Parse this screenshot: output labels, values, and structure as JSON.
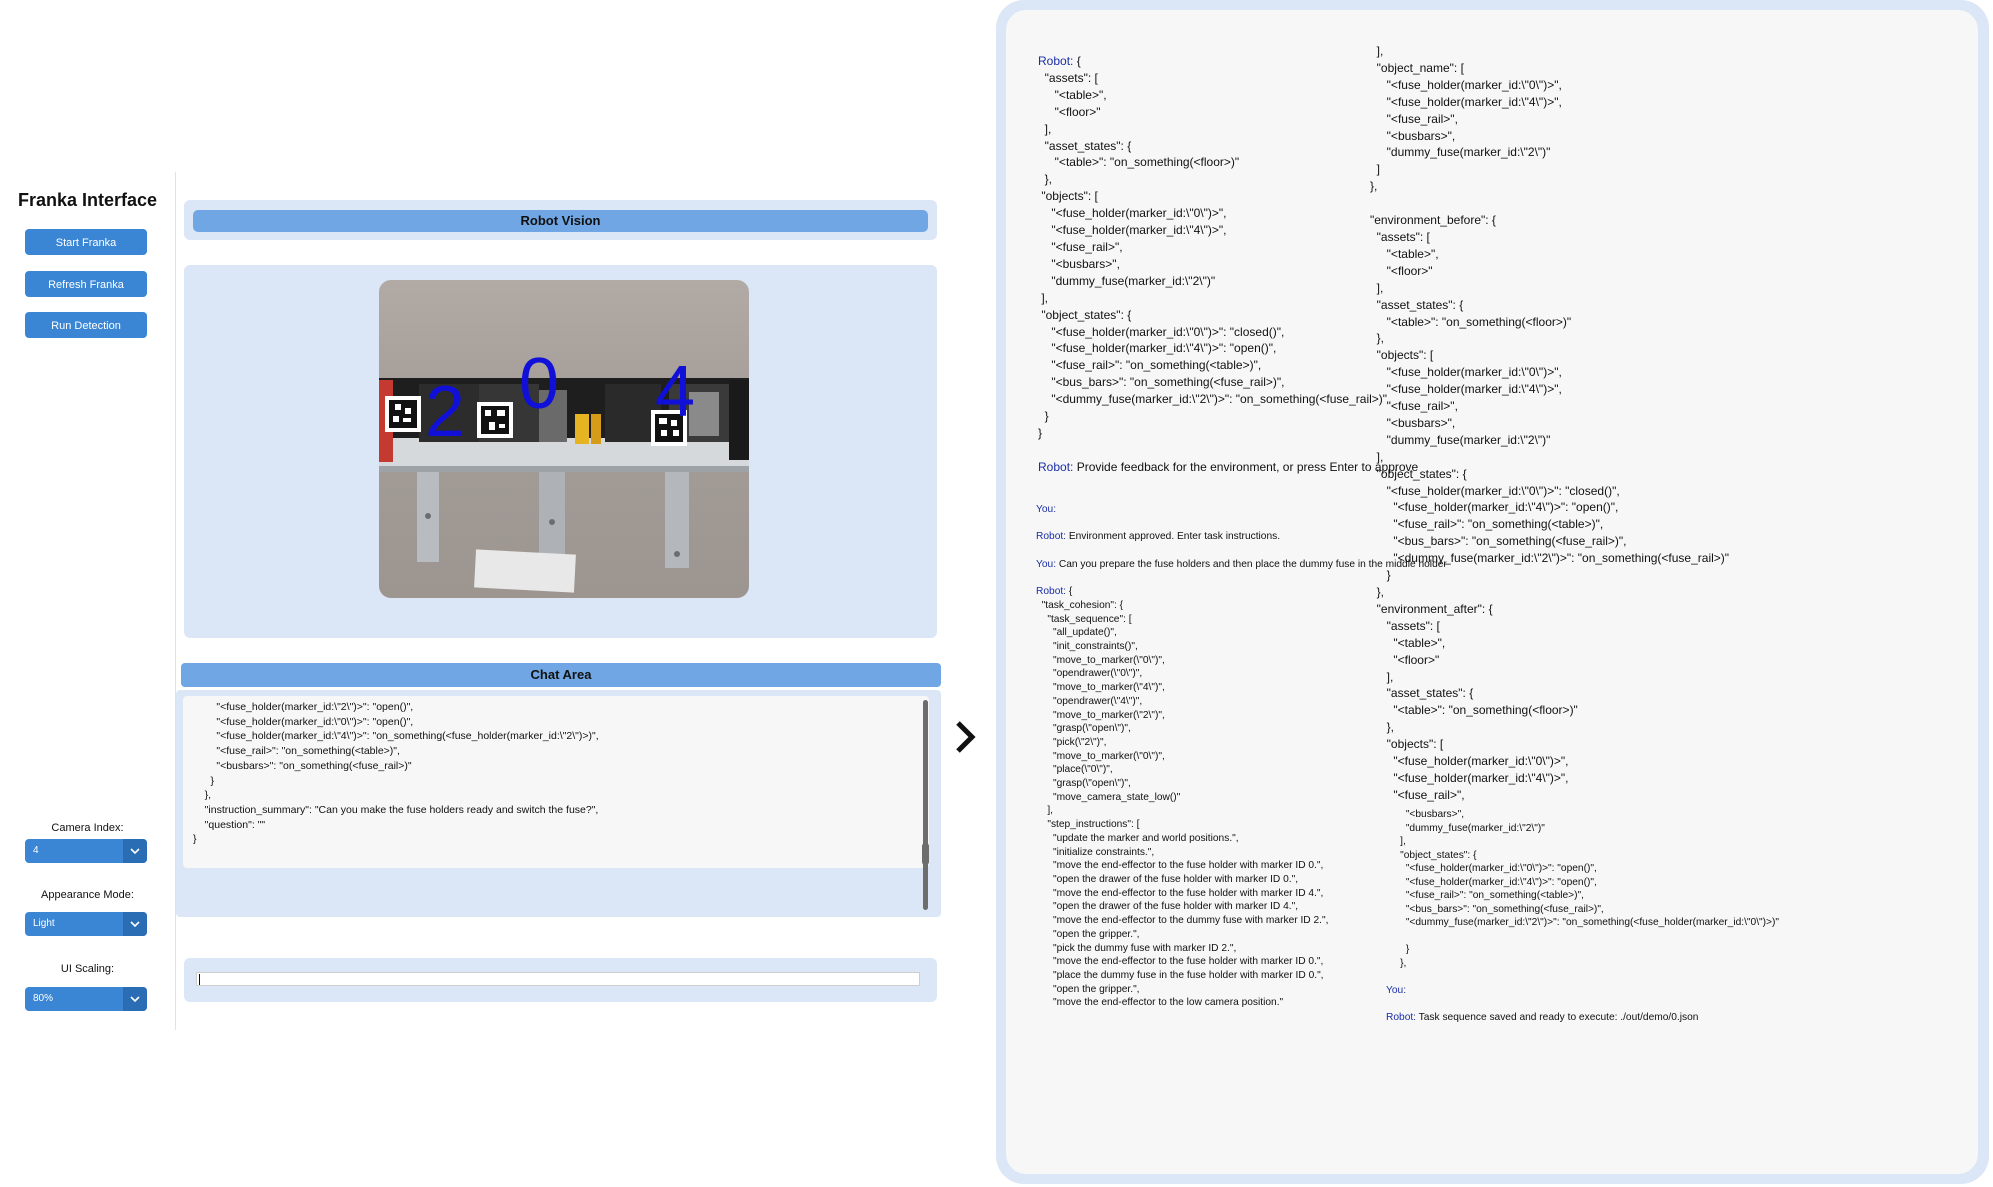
{
  "app": {
    "title": "Franka Interface"
  },
  "sidebar": {
    "buttons": {
      "start": "Start Franka",
      "refresh": "Refresh Franka",
      "detect": "Run Detection"
    },
    "camera_index": {
      "label": "Camera Index:",
      "value": "4"
    },
    "appearance_mode": {
      "label": "Appearance Mode:",
      "value": "Light"
    },
    "ui_scaling": {
      "label": "UI Scaling:",
      "value": "80%"
    }
  },
  "vision": {
    "title": "Robot Vision",
    "markers": [
      "2",
      "0",
      "4"
    ]
  },
  "chat": {
    "title": "Chat Area",
    "text": "        \"<fuse_holder(marker_id:\\\"2\\\")>\": \"open()\",\n        \"<fuse_holder(marker_id:\\\"0\\\")>\": \"open()\",\n        \"<fuse_holder(marker_id:\\\"4\\\")>\": \"on_something(<fuse_holder(marker_id:\\\"2\\\")>)\",\n        \"<fuse_rail>\": \"on_something(<table>)\",\n        \"<busbars>\": \"on_something(<fuse_rail>)\"\n      }\n    },\n    \"instruction_summary\": \"Can you make the fuse holders ready and switch the fuse?\",\n    \"question\": \"\"\n}",
    "input_value": ""
  },
  "colors": {
    "accent": "#3a86d4",
    "panel": "#dbe7f6",
    "header_bar": "#6fa6e3",
    "speaker": "#1a2ea6"
  },
  "log": {
    "col1a": [
      {
        "s": "Robot:",
        "t": " {"
      },
      {
        "t": "  \"assets\": ["
      },
      {
        "t": "     \"<table>\","
      },
      {
        "t": "     \"<floor>\""
      },
      {
        "t": "  ],"
      },
      {
        "t": "  \"asset_states\": {"
      },
      {
        "t": "     \"<table>\": \"on_something(<floor>)\""
      },
      {
        "t": "  },"
      },
      {
        "t": " \"objects\": ["
      },
      {
        "t": "    \"<fuse_holder(marker_id:\\\"0\\\")>\","
      },
      {
        "t": "    \"<fuse_holder(marker_id:\\\"4\\\")>\","
      },
      {
        "t": "    \"<fuse_rail>\","
      },
      {
        "t": "    \"<busbars>\","
      },
      {
        "t": "    \"dummy_fuse(marker_id:\\\"2\\\")\""
      },
      {
        "t": " ],"
      },
      {
        "t": " \"object_states\": {"
      },
      {
        "t": "    \"<fuse_holder(marker_id:\\\"0\\\")>\": \"closed()\","
      },
      {
        "t": "    \"<fuse_holder(marker_id:\\\"4\\\")>\": \"open()\","
      },
      {
        "t": "    \"<fuse_rail>\": \"on_something(<table>)\","
      },
      {
        "t": "    \"<bus_bars>\": \"on_something(<fuse_rail>)\","
      },
      {
        "t": "    \"<dummy_fuse(marker_id:\\\"2\\\")>\": \"on_something(<fuse_rail>)\""
      },
      {
        "t": "  }"
      },
      {
        "t": "}"
      },
      {
        "sp": 1
      },
      {
        "s": "Robot:",
        "t": " Provide feedback for the environment, or press Enter to approve"
      }
    ],
    "col1b": [
      {
        "s": "You:",
        "t": ""
      },
      {
        "sp": 1
      },
      {
        "s": "Robot:",
        "t": " Environment approved. Enter task instructions."
      },
      {
        "sp": 1
      },
      {
        "s": "You:",
        "t": " Can you prepare the fuse holders and then place the dummy fuse in the middle holder"
      },
      {
        "sp": 1
      },
      {
        "s": "Robot:",
        "t": " {"
      },
      {
        "t": "  \"task_cohesion\": {"
      },
      {
        "t": "    \"task_sequence\": ["
      },
      {
        "t": "      \"all_update()\","
      },
      {
        "t": "      \"init_constraints()\","
      },
      {
        "t": "      \"move_to_marker(\\\"0\\\")\","
      },
      {
        "t": "      \"opendrawer(\\\"0\\\")\","
      },
      {
        "t": "      \"move_to_marker(\\\"4\\\")\","
      },
      {
        "t": "      \"opendrawer(\\\"4\\\")\","
      },
      {
        "t": "      \"move_to_marker(\\\"2\\\")\","
      },
      {
        "t": "      \"grasp(\\\"open\\\")\","
      },
      {
        "t": "      \"pick(\\\"2\\\")\","
      },
      {
        "t": "      \"move_to_marker(\\\"0\\\")\","
      },
      {
        "t": "      \"place(\\\"0\\\")\","
      },
      {
        "t": "      \"grasp(\\\"open\\\")\","
      },
      {
        "t": "      \"move_camera_state_low()\""
      },
      {
        "t": "    ],"
      },
      {
        "t": "    \"step_instructions\": ["
      },
      {
        "t": "      \"update the marker and world positions.\","
      },
      {
        "t": "      \"initialize constraints.\","
      },
      {
        "t": "      \"move the end-effector to the fuse holder with marker ID 0.\","
      },
      {
        "t": "      \"open the drawer of the fuse holder with marker ID 0.\","
      },
      {
        "t": "      \"move the end-effector to the fuse holder with marker ID 4.\","
      },
      {
        "t": "      \"open the drawer of the fuse holder with marker ID 4.\","
      },
      {
        "t": "      \"move the end-effector to the dummy fuse with marker ID 2.\","
      },
      {
        "t": "      \"open the gripper.\","
      },
      {
        "t": "      \"pick the dummy fuse with marker ID 2.\","
      },
      {
        "t": "      \"move the end-effector to the fuse holder with marker ID 0.\","
      },
      {
        "t": "      \"place the dummy fuse in the fuse holder with marker ID 0.\","
      },
      {
        "t": "      \"open the gripper.\","
      },
      {
        "t": "      \"move the end-effector to the low camera position.\""
      }
    ],
    "col2a": [
      {
        "t": "  ],"
      },
      {
        "t": "  \"object_name\": ["
      },
      {
        "t": "     \"<fuse_holder(marker_id:\\\"0\\\")>\","
      },
      {
        "t": "     \"<fuse_holder(marker_id:\\\"4\\\")>\","
      },
      {
        "t": "     \"<fuse_rail>\","
      },
      {
        "t": "     \"<busbars>\","
      },
      {
        "t": "     \"dummy_fuse(marker_id:\\\"2\\\")\""
      },
      {
        "t": "  ]"
      },
      {
        "t": "},"
      },
      {
        "sp": 1
      },
      {
        "t": "\"environment_before\": {"
      },
      {
        "t": "  \"assets\": ["
      },
      {
        "t": "     \"<table>\","
      },
      {
        "t": "     \"<floor>\""
      },
      {
        "t": "  ],"
      },
      {
        "t": "  \"asset_states\": {"
      },
      {
        "t": "     \"<table>\": \"on_something(<floor>)\""
      },
      {
        "t": "  },"
      },
      {
        "t": "  \"objects\": ["
      },
      {
        "t": "     \"<fuse_holder(marker_id:\\\"0\\\")>\","
      },
      {
        "t": "     \"<fuse_holder(marker_id:\\\"4\\\")>\","
      },
      {
        "t": "     \"<fuse_rail>\","
      },
      {
        "t": "     \"<busbars>\","
      },
      {
        "t": "     \"dummy_fuse(marker_id:\\\"2\\\")\""
      },
      {
        "t": "  ],"
      },
      {
        "t": "  \"object_states\": {"
      },
      {
        "t": "     \"<fuse_holder(marker_id:\\\"0\\\")>\": \"closed()\","
      },
      {
        "t": "       \"<fuse_holder(marker_id:\\\"4\\\")>\": \"open()\","
      },
      {
        "t": "       \"<fuse_rail>\": \"on_something(<table>)\","
      },
      {
        "t": "       \"<bus_bars>\": \"on_something(<fuse_rail>)\","
      },
      {
        "t": "       \"<dummy_fuse(marker_id:\\\"2\\\")>\": \"on_something(<fuse_rail>)\""
      },
      {
        "t": "     }"
      },
      {
        "t": "  },"
      },
      {
        "t": "  \"environment_after\": {"
      },
      {
        "t": "     \"assets\": ["
      },
      {
        "t": "       \"<table>\","
      },
      {
        "t": "       \"<floor>\""
      },
      {
        "t": "     ],"
      },
      {
        "t": "     \"asset_states\": {"
      },
      {
        "t": "       \"<table>\": \"on_something(<floor>)\""
      },
      {
        "t": "     },"
      },
      {
        "t": "     \"objects\": ["
      },
      {
        "t": "       \"<fuse_holder(marker_id:\\\"0\\\")>\","
      },
      {
        "t": "       \"<fuse_holder(marker_id:\\\"4\\\")>\","
      },
      {
        "t": "       \"<fuse_rail>\","
      }
    ],
    "col2b": [
      {
        "t": "       \"<busbars>\","
      },
      {
        "t": "       \"dummy_fuse(marker_id:\\\"2\\\")\""
      },
      {
        "t": "     ],"
      },
      {
        "t": "     \"object_states\": {"
      },
      {
        "t": "       \"<fuse_holder(marker_id:\\\"0\\\")>\": \"open()\","
      },
      {
        "t": "       \"<fuse_holder(marker_id:\\\"4\\\")>\": \"open()\","
      },
      {
        "t": "       \"<fuse_rail>\": \"on_something(<table>)\","
      },
      {
        "t": "       \"<bus_bars>\": \"on_something(<fuse_rail>)\","
      },
      {
        "t": "       \"<dummy_fuse(marker_id:\\\"2\\\")>\": \"on_something(<fuse_holder(marker_id:\\\"0\\\")>)\""
      },
      {
        "sp": 1
      },
      {
        "t": "       }"
      },
      {
        "t": "     },"
      },
      {
        "sp": 1
      },
      {
        "s": "You:",
        "t": ""
      },
      {
        "sp": 1
      },
      {
        "s": "Robot:",
        "t": " Task sequence saved and ready to execute: ./out/demo/0.json"
      }
    ]
  }
}
